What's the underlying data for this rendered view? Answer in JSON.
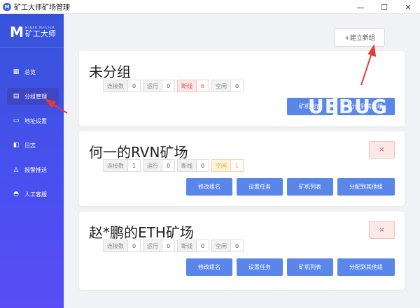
{
  "window": {
    "title": "矿工大师矿场管理",
    "icon_text": "M",
    "min": "—",
    "max": "☐",
    "close": "✕"
  },
  "logo": {
    "sub": "MINER MASTER",
    "main": "矿工大师",
    "mark": "M"
  },
  "sidebar": {
    "items": [
      {
        "label": "总览",
        "icon": "grid-icon",
        "glyph": "▦"
      },
      {
        "label": "分组管理",
        "icon": "document-icon",
        "glyph": "▤"
      },
      {
        "label": "地址设置",
        "icon": "wallet-icon",
        "glyph": "▭"
      },
      {
        "label": "日志",
        "icon": "log-icon",
        "glyph": "◧"
      },
      {
        "label": "报警推送",
        "icon": "bell-icon",
        "glyph": "◬"
      },
      {
        "label": "人工客服",
        "icon": "user-icon",
        "glyph": "◓"
      }
    ]
  },
  "toolbar": {
    "new_group": "+建立新组"
  },
  "groups": [
    {
      "name": "未分组",
      "stats": [
        {
          "label": "连接数",
          "value": "0"
        },
        {
          "label": "运行",
          "value": "0"
        },
        {
          "label": "断线",
          "value": "6"
        },
        {
          "label": "空闲",
          "value": "0"
        }
      ],
      "buttons": [
        "矿机列表",
        "分配到其他组"
      ]
    },
    {
      "name": "何一的RVN矿场",
      "stats": [
        {
          "label": "连接数",
          "value": "1"
        },
        {
          "label": "运行",
          "value": "0"
        },
        {
          "label": "断线",
          "value": "0"
        },
        {
          "label": "空闲",
          "value": "1"
        }
      ],
      "buttons": [
        "修改组名",
        "设置任务",
        "矿机列表",
        "分配到其他组"
      ],
      "delete": "×"
    },
    {
      "name": "赵*鹏的ETH矿场",
      "stats": [
        {
          "label": "连接数",
          "value": "0"
        },
        {
          "label": "运行",
          "value": "0"
        },
        {
          "label": "断线",
          "value": "0"
        },
        {
          "label": "空闲",
          "value": "0"
        }
      ],
      "buttons": [
        "修改组名",
        "设置任务",
        "矿机列表",
        "分配到其他组"
      ],
      "delete": "×"
    }
  ],
  "watermark": "UEBUG",
  "colors": {
    "sidebar": "#3654d9",
    "accent": "#5a86ea",
    "danger": "#e05555",
    "warning": "#f0a020",
    "arrow": "#e53935"
  }
}
